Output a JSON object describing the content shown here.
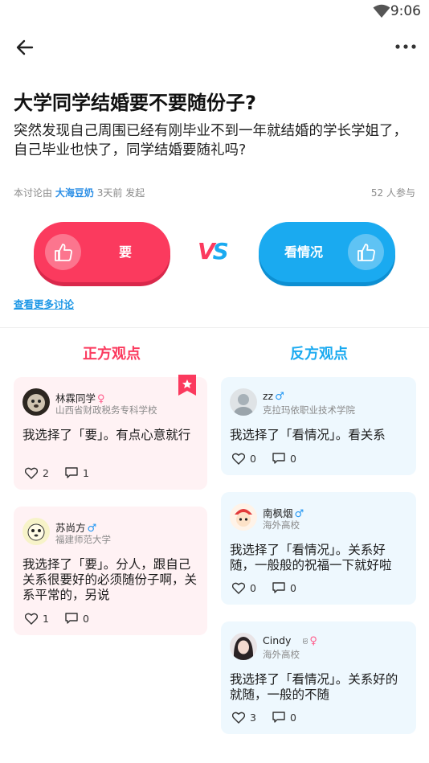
{
  "status_bar": {
    "time": "9:06"
  },
  "topic": {
    "title": "大学同学结婚要不要随份子?",
    "description": "突然发现自己周围已经有刚毕业不到一年就结婚的学长学姐了，自己毕业也快了，同学结婚要随礼吗?",
    "meta_prefix": "本讨论由",
    "author": "大海豆奶",
    "meta_suffix": "3天前 发起",
    "participants": "52 人参与"
  },
  "vote": {
    "yes_label": "要",
    "no_label": "看情况",
    "vs_v": "V",
    "vs_s": "S"
  },
  "more_link": "查看更多讨论",
  "columns": {
    "pro_title": "正方观点",
    "con_title": "反方观点"
  },
  "pro_cards": [
    {
      "name": "林霖同学",
      "gender": "♀",
      "school": "山西省财政税务专科学校",
      "content": "我选择了「要」。有点心意就行",
      "likes": "2",
      "comments": "1"
    },
    {
      "name": "苏尚方",
      "gender": "♂",
      "school": "福建师范大学",
      "content": "我选择了「要」。分人，跟自己关系很要好的必须随份子啊，关系平常的，另说",
      "likes": "1",
      "comments": "0"
    }
  ],
  "con_cards": [
    {
      "name": "zz",
      "gender": "♂",
      "school": "克拉玛依职业技术学院",
      "content": "我选择了「看情况」。看关系",
      "likes": "0",
      "comments": "0"
    },
    {
      "name": "南枫烟",
      "gender": "♂",
      "school": "海外高校",
      "content": "我选择了「看情况」。关系好随，一般般的祝福一下就好啦",
      "likes": "0",
      "comments": "0"
    },
    {
      "name": "Cindy",
      "badge": "ଞ",
      "gender": "♀",
      "school": "海外高校",
      "content": "我选择了「看情况」。关系好的就随，一般的不随",
      "likes": "3",
      "comments": "0"
    }
  ],
  "colors": {
    "pro": "#fb3a5e",
    "con": "#1aaaf0",
    "link": "#1d97e6"
  },
  "icons": [
    "wifi-icon",
    "back-arrow-icon",
    "more-icon",
    "thumbs-up-icon",
    "bookmark-icon",
    "heart-icon",
    "comment-icon"
  ]
}
